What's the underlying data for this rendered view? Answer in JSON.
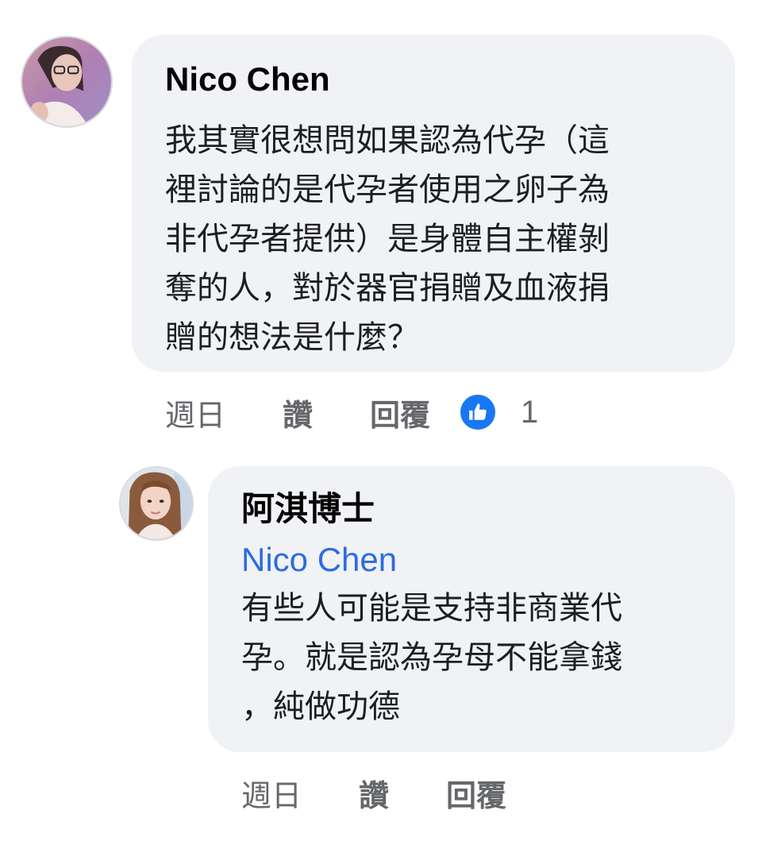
{
  "comments": [
    {
      "author": "Nico Chen",
      "lines": [
        "我其實很想問如果認為代孕（這",
        "裡討論的是代孕者使用之卵子為",
        "非代孕者提供）是身體自主權剝",
        "奪的人，對於器官捐贈及血液捐",
        "贈的想法是什麼？"
      ],
      "time": "週日",
      "like_label": "讚",
      "reply_label": "回覆",
      "reaction_count": "1"
    },
    {
      "author": "阿淇博士",
      "mention": "Nico Chen",
      "lines": [
        "有些人可能是支持非商業代",
        "孕。就是認為孕母不能拿錢",
        "，純做功德"
      ],
      "time": "週日",
      "like_label": "讚",
      "reply_label": "回覆"
    }
  ],
  "colors": {
    "bubble": "#f0f2f5",
    "mention": "#2d6cdf",
    "like_blue": "#1877f2",
    "meta_gray": "#65676b"
  },
  "icons": {
    "reaction": "thumbs-up-icon"
  }
}
